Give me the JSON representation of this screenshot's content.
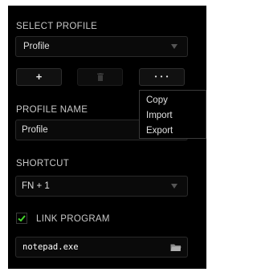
{
  "select_profile": {
    "label": "SELECT PROFILE",
    "selected": "Profile"
  },
  "profile_buttons": {
    "add_label": "+",
    "more_label": "• • •"
  },
  "context_menu": {
    "items": [
      {
        "label": "Copy"
      },
      {
        "label": "Import"
      },
      {
        "label": "Export"
      }
    ]
  },
  "profile_name": {
    "label": "PROFILE NAME",
    "value": "Profile"
  },
  "shortcut": {
    "label": "SHORTCUT",
    "selected": "FN + 1"
  },
  "link_program": {
    "label": "LINK PROGRAM",
    "checked": true,
    "value": "notepad.exe"
  },
  "colors": {
    "panel_bg": "#000000",
    "accent_green": "#44d62c",
    "text": "#e0e0e0",
    "label_text": "#c8c8c8"
  }
}
